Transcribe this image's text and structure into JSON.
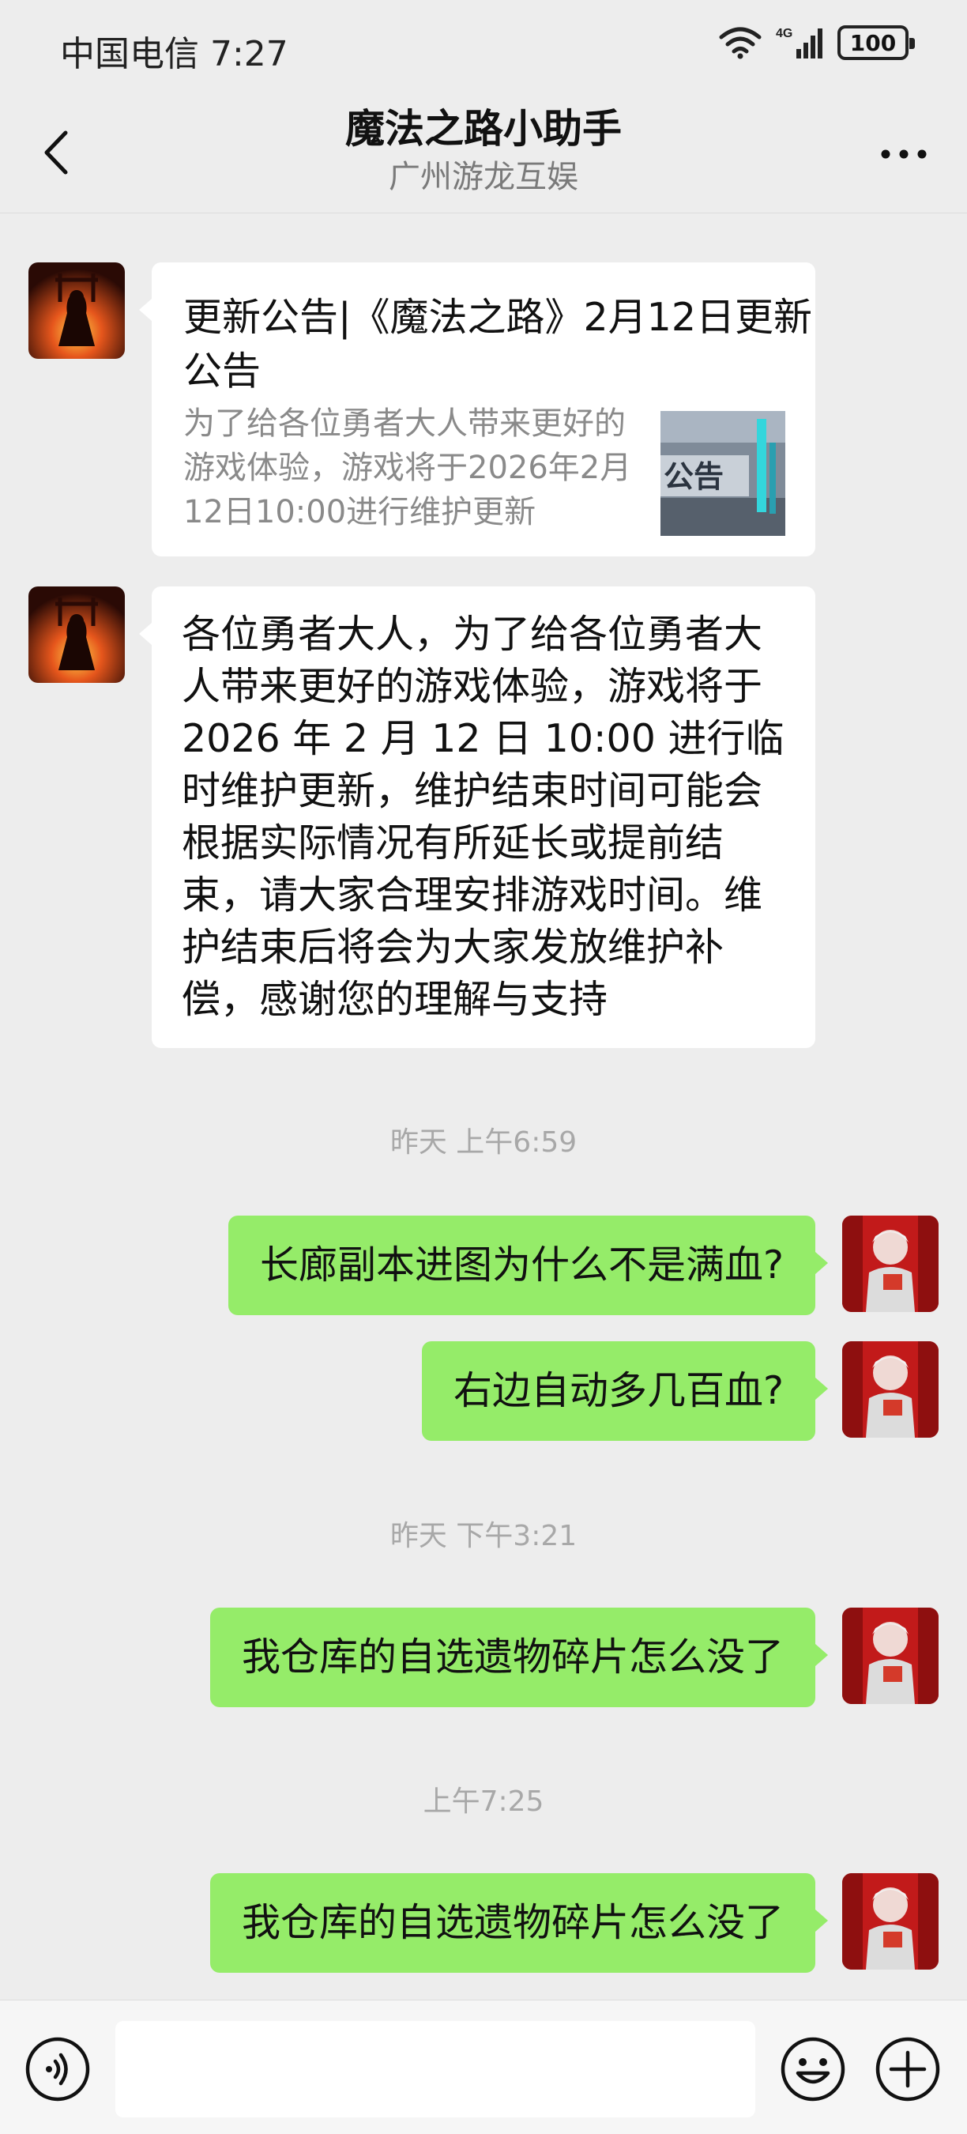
{
  "status_bar": {
    "carrier_time": "中国电信 7:27",
    "network": "4G",
    "battery": "100"
  },
  "header": {
    "title": "魔法之路小助手",
    "subtitle": "广州游龙互娱"
  },
  "messages": {
    "article": {
      "title": "更新公告|《魔法之路》2月12日更新公告",
      "description": "为了给各位勇者大人带来更好的游戏体验，游戏将于2026年2月12日10:00进行维护更新",
      "thumbnail_text": "公告"
    },
    "notice": {
      "text": "各位勇者大人，为了给各位勇者大人带来更好的游戏体验，游戏将于 2026 年 2 月 12 日 10:00 进行临时维护更新，维护结束时间可能会根据实际情况有所延长或提前结束，请大家合理安排游戏时间。维护结束后将会为大家发放维护补偿，感谢您的理解与支持"
    },
    "time_1": "昨天 上午6:59",
    "sent_1": "长廊副本进图为什么不是满血?",
    "sent_2": "右边自动多几百血?",
    "time_2": "昨天 下午3:21",
    "sent_3": "我仓库的自选遗物碎片怎么没了",
    "time_3": "上午7:25",
    "sent_4": "我仓库的自选遗物碎片怎么没了"
  },
  "input": {
    "value": "",
    "placeholder": ""
  },
  "icons": {
    "back": "chevron-left-icon",
    "more": "more-dots-icon",
    "voice": "voice-icon",
    "emoji": "emoji-icon",
    "plus": "plus-icon"
  },
  "colors": {
    "background": "#ededed",
    "incoming_bubble": "#ffffff",
    "outgoing_bubble": "#95ec69",
    "timestamp": "#a8a8a8"
  }
}
